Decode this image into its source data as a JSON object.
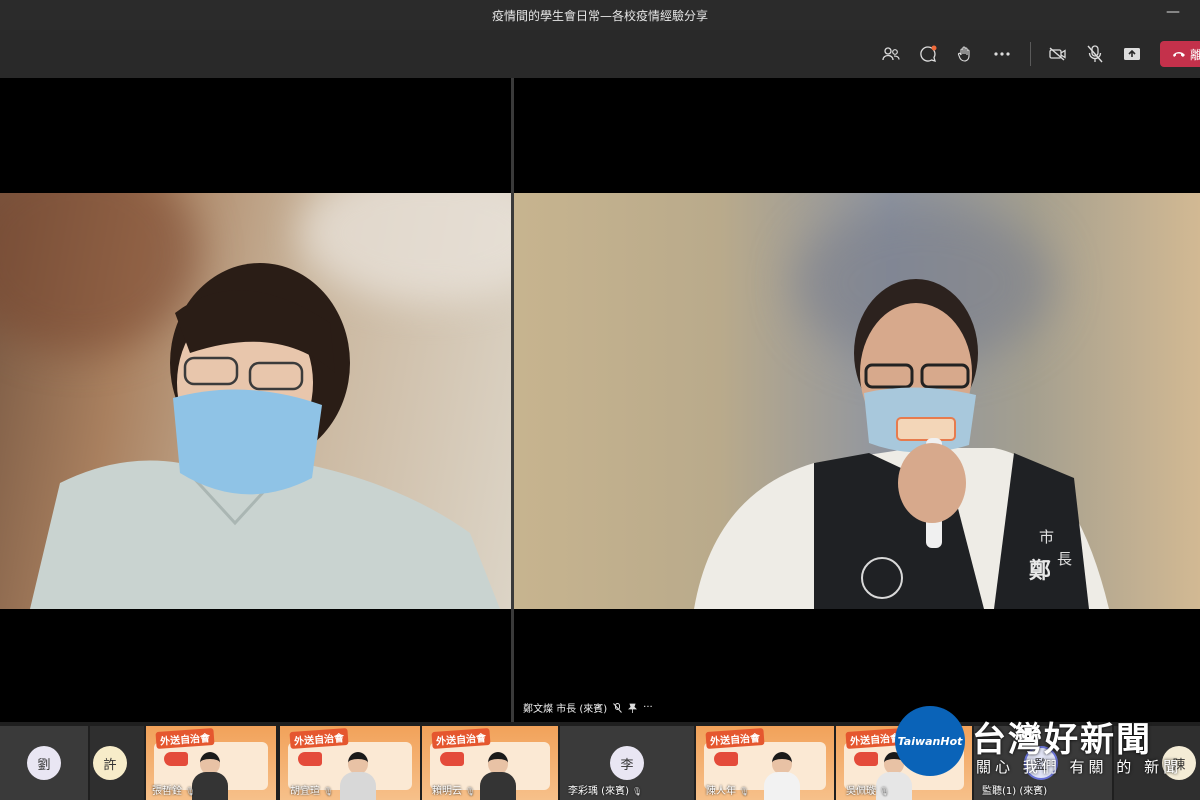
{
  "window": {
    "title": "疫情間的學生會日常—各校疫情經驗分享",
    "minimize": "—"
  },
  "toolbar": {
    "leave_icon": "phone-hangup-icon",
    "leave_label": "離"
  },
  "stage": {
    "caption": {
      "name": "鄭文燦 市長 (來賓)",
      "more": "···"
    },
    "vest_text": {
      "line1": "市",
      "line2": "長",
      "big": "鄭"
    }
  },
  "participants": [
    {
      "initial": "劉"
    },
    {
      "initial": "許"
    },
    {
      "banner": "外送自治會",
      "name": "張哲銓"
    },
    {
      "banner": "外送自治會",
      "name": "胡宜瑄"
    },
    {
      "banner": "外送自治會",
      "name": "賴明云"
    },
    {
      "initial": "李",
      "name": "李彩瑀 (來賓)"
    },
    {
      "banner": "外送自治會",
      "name": "陳人年"
    },
    {
      "banner": "外送自治會",
      "name": "吳佩璇"
    },
    {
      "initial": "監",
      "name": "監聽(1) (來賓)"
    },
    {
      "initial": "陳"
    }
  ],
  "watermark": {
    "logo_text": "TaiwanHot",
    "title": "台灣好新聞",
    "subtitle": "關心 我們 有關 的 新聞"
  },
  "colors": {
    "leave": "#c4314b",
    "notification": "#f06a3a",
    "banner": "#e5572f"
  }
}
